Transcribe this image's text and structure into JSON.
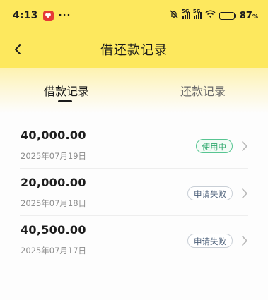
{
  "status_bar": {
    "time": "4:13",
    "more": "···",
    "network_1": "5G",
    "network_2": "5G",
    "battery_level": 87,
    "battery_text": "87",
    "battery_unit": "%"
  },
  "header": {
    "title": "借还款记录"
  },
  "tabs": [
    {
      "label": "借款记录",
      "active": true
    },
    {
      "label": "还款记录",
      "active": false
    }
  ],
  "records": [
    {
      "amount": "40,000.00",
      "date": "2025年07月19日",
      "status": "使用中"
    },
    {
      "amount": "20,000.00",
      "date": "2025年07月18日",
      "status": "申请失败"
    },
    {
      "amount": "40,500.00",
      "date": "2025年07月17日",
      "status": "申请失败"
    }
  ],
  "colors": {
    "header_bg": "#fde85e",
    "status_active": "#2ea86c",
    "status_failed": "#4a5e78"
  }
}
